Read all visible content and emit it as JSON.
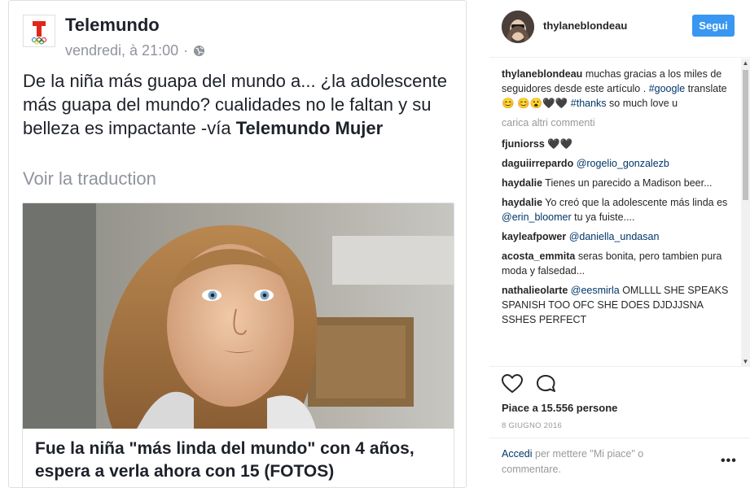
{
  "facebook": {
    "page_name": "Telemundo",
    "timestamp": "vendredi, à 21:00",
    "separator": "·",
    "privacy_icon": "globe-icon",
    "post_text_main": "De la niña más guapa del mundo a... ¿la adolescente más guapa del mundo? cualidades no le faltan y su belleza es impactante -vía",
    "post_text_source": "Telemundo Mujer",
    "translate_label": "Voir la traduction",
    "link_title": "Fue la niña \"más linda del mundo\" con 4 años, espera a verla ahora con 15 (FOTOS)"
  },
  "instagram": {
    "username": "thylaneblondeau",
    "follow_label": "Segui",
    "caption": {
      "user": "thylaneblondeau",
      "text_1": "muchas gracias a los miles de seguidores desde este artículo .",
      "tag_1": "#google",
      "text_2": "translate 😊 😊😮🖤🖤",
      "tag_2": "#thanks",
      "text_3": "so much love u"
    },
    "load_more_label": "carica altri commenti",
    "comments": [
      {
        "user": "fjuniorss",
        "parts": [
          {
            "t": "🖤🖤",
            "tag": false
          }
        ]
      },
      {
        "user": "daguiirrepardo",
        "parts": [
          {
            "t": "@rogelio_gonzalezb",
            "tag": true
          }
        ]
      },
      {
        "user": "haydalie",
        "parts": [
          {
            "t": "Tienes un parecido a Madison beer...",
            "tag": false
          }
        ]
      },
      {
        "user": "haydalie",
        "parts": [
          {
            "t": "Yo creó que la adolescente más linda es",
            "tag": false
          },
          {
            "t": "@erin_bloomer",
            "tag": true
          },
          {
            "t": "tu ya fuiste....",
            "tag": false
          }
        ]
      },
      {
        "user": "kayleafpower",
        "parts": [
          {
            "t": "@daniella_undasan",
            "tag": true
          }
        ]
      },
      {
        "user": "acosta_emmita",
        "parts": [
          {
            "t": "seras bonita, pero tambien pura moda y falsedad...",
            "tag": false
          }
        ]
      },
      {
        "user": "nathalieolarte",
        "parts": [
          {
            "t": "@eesmirla",
            "tag": true
          },
          {
            "t": "OMLLLL SHE SPEAKS SPANISH TOO OFC SHE DOES DJDJJSNA SSHES PERFECT",
            "tag": false
          }
        ]
      }
    ],
    "like_icon": "heart-icon",
    "comment_icon": "comment-icon",
    "likes_text": "Piace a 15.556 persone",
    "date": "8 GIUGNO 2016",
    "login_link": "Accedi",
    "login_text": "per mettere \"Mi piace\" o commentare.",
    "more_label": "•••",
    "colors": {
      "follow_button": "#3897f0",
      "hashtag_link": "#003569",
      "muted": "#999999"
    }
  }
}
